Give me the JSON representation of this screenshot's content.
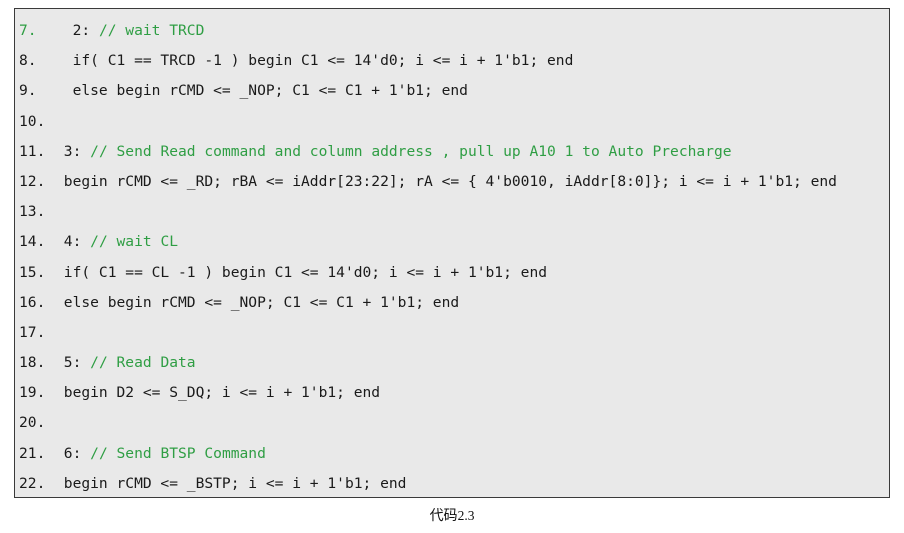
{
  "figure": {
    "caption_label": "代码",
    "caption_number": "2.3",
    "accent_comment_color": "#2f9e44",
    "code_text_color": "#1a1a1a",
    "code_background_color": "#e9e9e9",
    "code_border_color": "#3a3a3a",
    "page_background_color": "#ffffff"
  },
  "code": {
    "language": "Verilog",
    "first_line_number": 7,
    "last_line_number": 22,
    "lines": [
      {
        "number": "7.",
        "number_color": "green",
        "segments": [
          {
            "kind": "code",
            "text": "  2: "
          },
          {
            "kind": "comment",
            "text": "// wait TRCD"
          }
        ],
        "plain": "  2: // wait TRCD"
      },
      {
        "number": "8.",
        "number_color": "dark",
        "segments": [
          {
            "kind": "code",
            "text": "  if( C1 == TRCD -1 ) begin C1 <= 14'd0; i <= i + 1'b1; end"
          }
        ],
        "plain": "  if( C1 == TRCD -1 ) begin C1 <= 14'd0; i <= i + 1'b1; end"
      },
      {
        "number": "9.",
        "number_color": "dark",
        "segments": [
          {
            "kind": "code",
            "text": "  else begin rCMD <= _NOP; C1 <= C1 + 1'b1; end"
          }
        ],
        "plain": "  else begin rCMD <= _NOP; C1 <= C1 + 1'b1; end"
      },
      {
        "number": "10.",
        "number_color": "dark",
        "segments": [
          {
            "kind": "code",
            "text": ""
          }
        ],
        "plain": ""
      },
      {
        "number": "11.",
        "number_color": "dark",
        "segments": [
          {
            "kind": "code",
            "text": " 3: "
          },
          {
            "kind": "comment",
            "text": "// Send Read command and column address , pull up A10 1 to Auto Precharge"
          }
        ],
        "plain": " 3: // Send Read command and column address , pull up A10 1 to Auto Precharge"
      },
      {
        "number": "12.",
        "number_color": "dark",
        "segments": [
          {
            "kind": "code",
            "text": " begin rCMD <= _RD; rBA <= iAddr[23:22]; rA <= { 4'b0010, iAddr[8:0]}; i <= i + 1'b1; end"
          }
        ],
        "plain": " begin rCMD <= _RD; rBA <= iAddr[23:22]; rA <= { 4'b0010, iAddr[8:0]}; i <= i + 1'b1; end"
      },
      {
        "number": "13.",
        "number_color": "dark",
        "segments": [
          {
            "kind": "code",
            "text": ""
          }
        ],
        "plain": ""
      },
      {
        "number": "14.",
        "number_color": "dark",
        "segments": [
          {
            "kind": "code",
            "text": " 4: "
          },
          {
            "kind": "comment",
            "text": "// wait CL"
          }
        ],
        "plain": " 4: // wait CL"
      },
      {
        "number": "15.",
        "number_color": "dark",
        "segments": [
          {
            "kind": "code",
            "text": " if( C1 == CL -1 ) begin C1 <= 14'd0; i <= i + 1'b1; end"
          }
        ],
        "plain": " if( C1 == CL -1 ) begin C1 <= 14'd0; i <= i + 1'b1; end"
      },
      {
        "number": "16.",
        "number_color": "dark",
        "segments": [
          {
            "kind": "code",
            "text": " else begin rCMD <= _NOP; C1 <= C1 + 1'b1; end"
          }
        ],
        "plain": " else begin rCMD <= _NOP; C1 <= C1 + 1'b1; end"
      },
      {
        "number": "17.",
        "number_color": "dark",
        "segments": [
          {
            "kind": "code",
            "text": ""
          }
        ],
        "plain": ""
      },
      {
        "number": "18.",
        "number_color": "dark",
        "segments": [
          {
            "kind": "code",
            "text": " 5: "
          },
          {
            "kind": "comment",
            "text": "// Read Data"
          }
        ],
        "plain": " 5: // Read Data"
      },
      {
        "number": "19.",
        "number_color": "dark",
        "segments": [
          {
            "kind": "code",
            "text": " begin D2 <= S_DQ; i <= i + 1'b1; end"
          }
        ],
        "plain": " begin D2 <= S_DQ; i <= i + 1'b1; end"
      },
      {
        "number": "20.",
        "number_color": "dark",
        "segments": [
          {
            "kind": "code",
            "text": ""
          }
        ],
        "plain": ""
      },
      {
        "number": "21.",
        "number_color": "dark",
        "segments": [
          {
            "kind": "code",
            "text": " 6: "
          },
          {
            "kind": "comment",
            "text": "// Send BTSP Command"
          }
        ],
        "plain": " 6: // Send BTSP Command"
      },
      {
        "number": "22.",
        "number_color": "dark",
        "segments": [
          {
            "kind": "code",
            "text": " begin rCMD <= _BSTP; i <= i + 1'b1; end"
          }
        ],
        "plain": " begin rCMD <= _BSTP; i <= i + 1'b1; end"
      }
    ]
  }
}
